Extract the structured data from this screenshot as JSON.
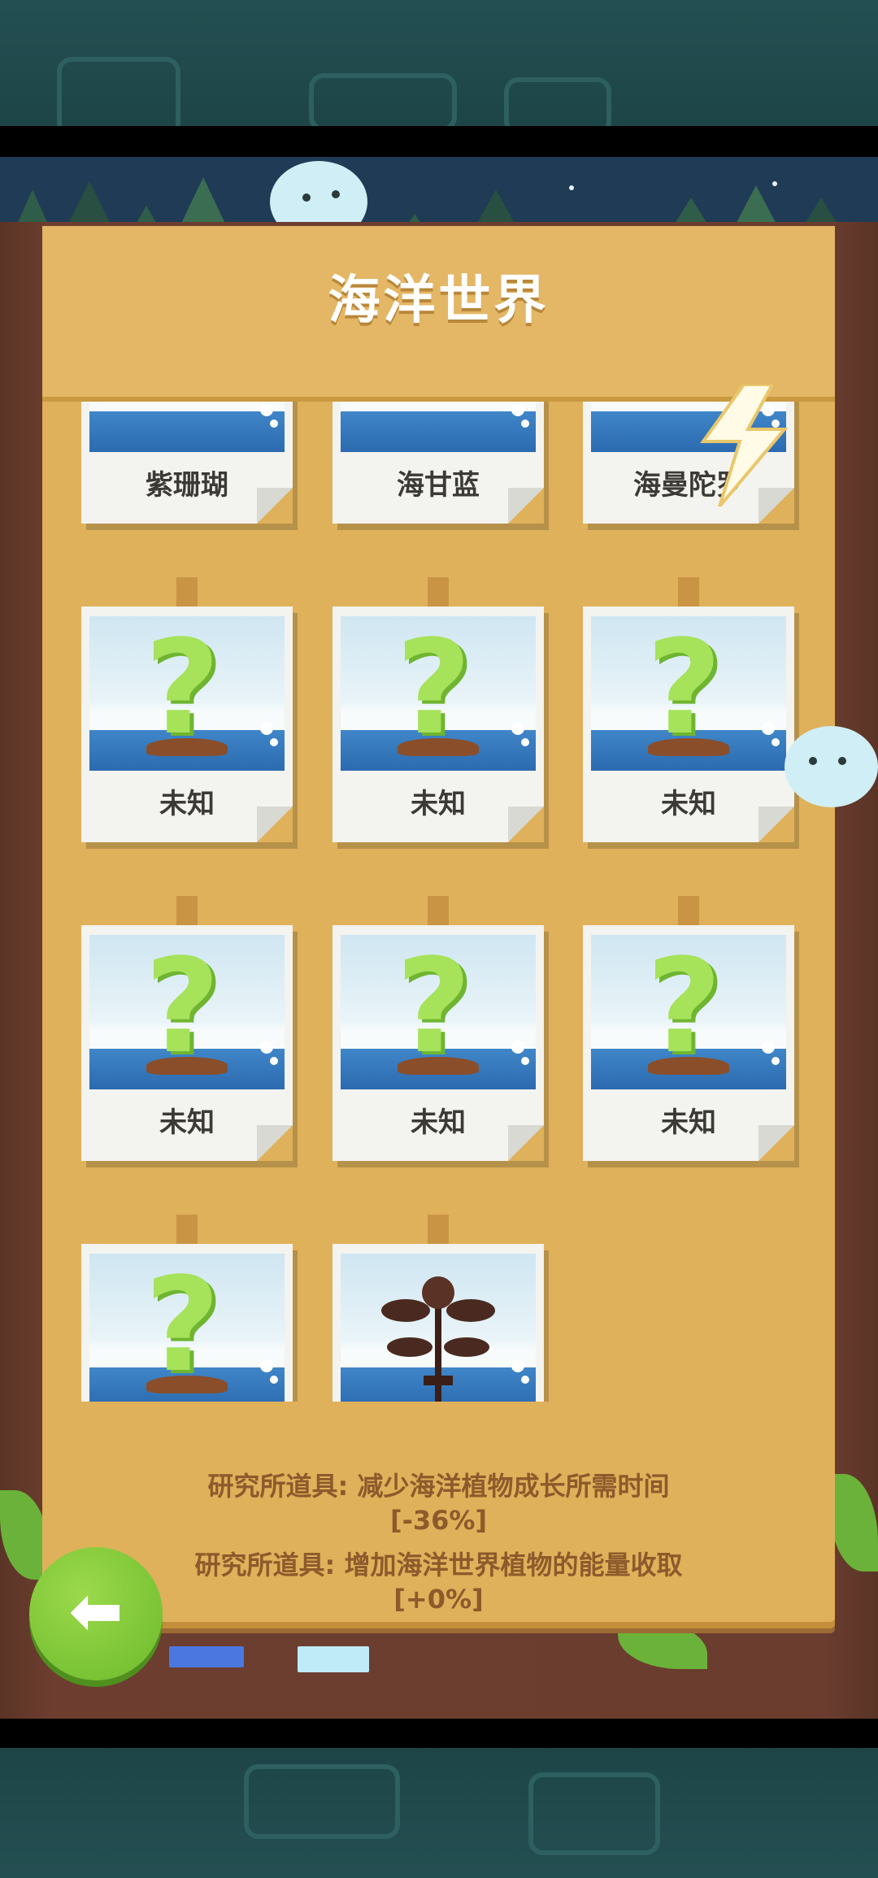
{
  "header": {
    "title": "海洋世界"
  },
  "grid": {
    "cards": [
      {
        "label": "紫珊瑚",
        "kind": "coral"
      },
      {
        "label": "海甘蓝",
        "kind": "cabbage"
      },
      {
        "label": "海曼陀罗",
        "kind": "datura"
      },
      {
        "label": "未知",
        "kind": "unknown"
      },
      {
        "label": "未知",
        "kind": "unknown"
      },
      {
        "label": "未知",
        "kind": "unknown"
      },
      {
        "label": "未知",
        "kind": "unknown"
      },
      {
        "label": "未知",
        "kind": "unknown"
      },
      {
        "label": "未知",
        "kind": "unknown"
      },
      {
        "label": "",
        "kind": "unknown"
      },
      {
        "label": "",
        "kind": "dark-plant"
      }
    ]
  },
  "bonuses": {
    "line1": "研究所道具: 减少海洋植物成长所需时间",
    "value1": "[-36%]",
    "line2": "研究所道具: 增加海洋世界植物的能量收取",
    "value2": "[+0%]"
  },
  "colors": {
    "board": "#dfb15a",
    "wood": "#6a3d2f",
    "sea": "#2c6ab0",
    "accent_green": "#7ec63a"
  },
  "icons": {
    "back": "arrow-left-icon",
    "unknown": "question-mark-icon"
  }
}
